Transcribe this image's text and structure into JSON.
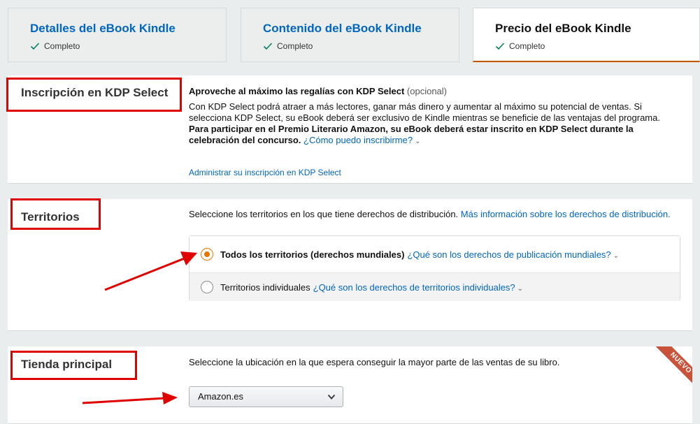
{
  "tabs": [
    {
      "title": "Detalles del eBook Kindle",
      "status": "Completo"
    },
    {
      "title": "Contenido del eBook Kindle",
      "status": "Completo"
    },
    {
      "title": "Precio del eBook Kindle",
      "status": "Completo"
    }
  ],
  "kdp_select": {
    "title": "Inscripción en KDP Select",
    "lead": "Aproveche al máximo las regalías con KDP Select",
    "optional": "(opcional)",
    "body": "Con KDP Select podrá atraer a más lectores, ganar más dinero y aumentar al máximo su potencial de ventas. Si selecciona KDP Select, su eBook deberá ser exclusivo de Kindle mientras se beneficie de las ventajas del programa.",
    "body_bold": "Para participar en el Premio Literario Amazon, su eBook deberá estar inscrito en KDP Select durante la celebración del concurso.",
    "how_link": "¿Cómo puedo inscribirme?",
    "manage_link": "Administrar su inscripción en KDP Select"
  },
  "territories": {
    "title": "Territorios",
    "intro": "Seleccione los territorios en los que tiene derechos de distribución.",
    "more_link": "Más información sobre los derechos de distribución.",
    "options": [
      {
        "label": "Todos los territorios (derechos mundiales)",
        "link": "¿Qué son los derechos de publicación mundiales?",
        "selected": true
      },
      {
        "label": "Territorios individuales",
        "link": "¿Qué son los derechos de territorios individuales?",
        "selected": false
      }
    ]
  },
  "marketplace": {
    "title": "Tienda principal",
    "intro": "Seleccione la ubicación en la que espera conseguir la mayor parte de las ventas de su libro.",
    "selected": "Amazon.es",
    "badge": "NUEVO"
  },
  "colors": {
    "link": "#0066c0",
    "annotation_red": "#e00000",
    "radio_orange": "#e77600",
    "badge": "#c9533a"
  }
}
